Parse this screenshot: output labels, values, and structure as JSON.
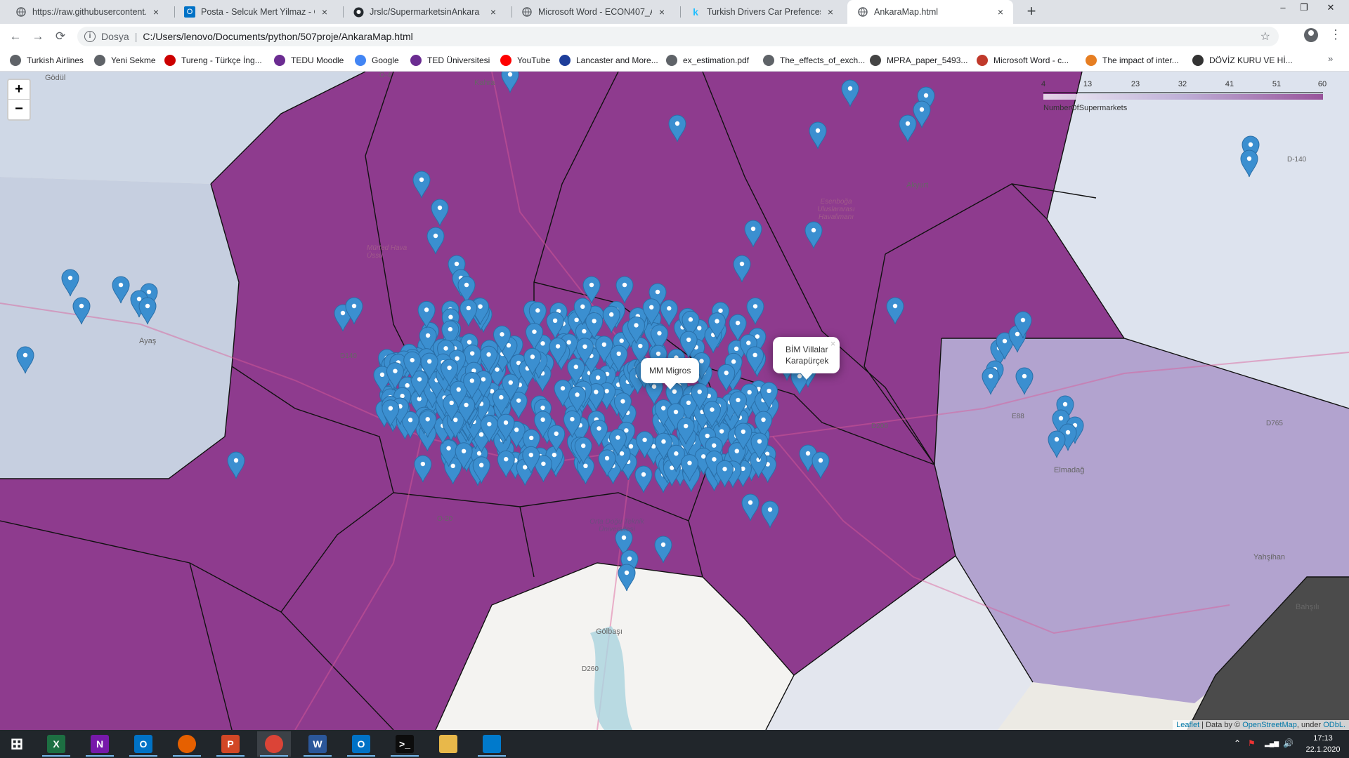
{
  "browser": {
    "tabs": [
      {
        "title": "https://raw.githubusercontent.co",
        "icon": "globe-icon",
        "active": false
      },
      {
        "title": "Posta - Selcuk Mert Yilmaz - Out",
        "icon": "outlook-icon",
        "active": false
      },
      {
        "title": "Jrslc/SupermarketsinAnkara",
        "icon": "github-icon",
        "active": false
      },
      {
        "title": "Microsoft Word - ECON407_ADS",
        "icon": "globe-icon",
        "active": false
      },
      {
        "title": "Turkish Drivers Car Prefences | Ka",
        "icon": "kaggle-icon",
        "active": false
      },
      {
        "title": "AnkaraMap.html",
        "icon": "globe-icon",
        "active": true
      }
    ],
    "new_tab_label": "+",
    "window_controls": {
      "minimize": "–",
      "restore": "❐",
      "close": "✕"
    },
    "toolbar": {
      "back": "←",
      "forward": "→",
      "reload": "⟳"
    },
    "address_bar": {
      "site_label": "Dosya",
      "url": "C:/Users/lenovo/Documents/python/507proje/AnkaraMap.html",
      "info_icon": "i",
      "star": "☆"
    },
    "menu_icon": "⋮",
    "bookmarks": [
      {
        "label": "Turkish Airlines",
        "icon": "globe-icon",
        "color": "#5f6368"
      },
      {
        "label": "Yeni Sekme",
        "icon": "globe-icon",
        "color": "#5f6368"
      },
      {
        "label": "Tureng - Türkçe İng...",
        "icon": "tureng-icon",
        "color": "#c00"
      },
      {
        "label": "TEDU Moodle",
        "icon": "moodle-icon",
        "color": "#6b2c91"
      },
      {
        "label": "Google",
        "icon": "google-icon",
        "color": "#4285f4"
      },
      {
        "label": "TED Üniversitesi",
        "icon": "ted-icon",
        "color": "#6b2c91"
      },
      {
        "label": "YouTube",
        "icon": "youtube-icon",
        "color": "#ff0000"
      },
      {
        "label": "Lancaster and More...",
        "icon": "eu-icon",
        "color": "#1e3e9a"
      },
      {
        "label": "ex_estimation.pdf",
        "icon": "globe-icon",
        "color": "#5f6368"
      },
      {
        "label": "The_effects_of_exch...",
        "icon": "globe-icon",
        "color": "#5f6368"
      },
      {
        "label": "MPRA_paper_5493...",
        "icon": "mpra-icon",
        "color": "#444"
      },
      {
        "label": "Microsoft Word - c...",
        "icon": "word-icon",
        "color": "#c0392b"
      },
      {
        "label": "The impact of inter...",
        "icon": "e-icon",
        "color": "#e67e22"
      },
      {
        "label": "DÖVİZ KURU VE Hİ...",
        "icon": "pkp-icon",
        "color": "#333"
      }
    ],
    "bookmarks_more": "»"
  },
  "map": {
    "zoom_in": "+",
    "zoom_out": "−",
    "legend": {
      "ticks": [
        "4",
        "13",
        "23",
        "32",
        "41",
        "51",
        "60"
      ],
      "caption": "NumberOfSupermarkets",
      "color_low": "#f3eef6",
      "color_high": "#8c3a8c"
    },
    "popups": [
      {
        "lines": [
          "MM Migros"
        ],
        "closable": false
      },
      {
        "lines": [
          "BİM Villalar",
          "Karapürçek"
        ],
        "closable": true,
        "close": "×"
      }
    ],
    "place_labels": [
      "Kahra",
      "Gödül",
      "Ayaş",
      "Akyurt",
      "Esenboğa Uluslararası Havalimanı",
      "Mürted Hava Üssü",
      "Elmadağ",
      "Yahşihan",
      "Bahşılı",
      "Gölbaşı",
      "Orta Doğu Teknik Üniversitesi",
      "D-140",
      "D140",
      "D200",
      "D765",
      "O-20",
      "E88",
      "D260",
      "O-4",
      "Kazan"
    ],
    "attribution": {
      "leaflet": "Leaflet",
      "text": " | Data by © ",
      "osm": "OpenStreetMap",
      "under": ", under ",
      "odbl": "ODbL."
    },
    "colors": {
      "purple": "#8e3b8e",
      "lavender": "#b9a6d3",
      "pale": "#cfd8e6",
      "white": "#f4f3f1",
      "dark": "#4b4b4b",
      "marker": "#3b8fd0"
    }
  },
  "taskbar": {
    "apps": [
      {
        "name": "start",
        "icon": "windows-icon",
        "label": "⊞"
      },
      {
        "name": "excel",
        "icon": "excel-icon",
        "label": "X"
      },
      {
        "name": "onenote",
        "icon": "onenote-icon",
        "label": "N"
      },
      {
        "name": "outlook",
        "icon": "outlook-icon",
        "label": "O"
      },
      {
        "name": "firefox",
        "icon": "firefox-icon",
        "label": ""
      },
      {
        "name": "powerpoint",
        "icon": "powerpoint-icon",
        "label": "P"
      },
      {
        "name": "chrome",
        "icon": "chrome-icon",
        "label": ""
      },
      {
        "name": "word",
        "icon": "word-icon",
        "label": "W"
      },
      {
        "name": "outlook2",
        "icon": "outlook-icon",
        "label": "O"
      },
      {
        "name": "terminal",
        "icon": "terminal-icon",
        "label": ">_"
      },
      {
        "name": "explorer",
        "icon": "folder-icon",
        "label": ""
      },
      {
        "name": "vscode",
        "icon": "vscode-icon",
        "label": ""
      }
    ],
    "tray": {
      "chevron": "⌃",
      "flag": "⚑",
      "network": "▂▄▆",
      "volume": "🔊"
    },
    "clock": {
      "time": "17:13",
      "date": "22.1.2020"
    }
  }
}
